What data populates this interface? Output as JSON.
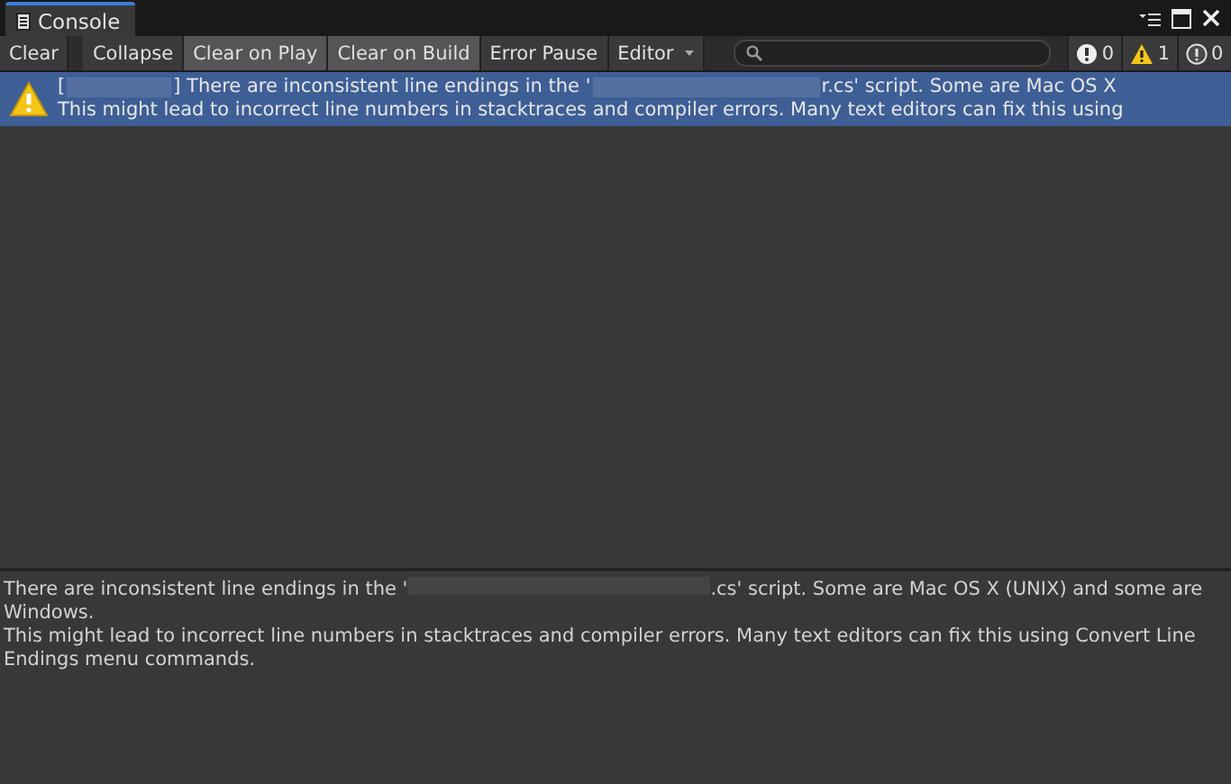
{
  "window": {
    "tab": "Console"
  },
  "toolbar": {
    "buttons": [
      {
        "label": "Clear",
        "kind": "button",
        "selected": false
      },
      {
        "label": "Collapse",
        "kind": "toggle",
        "selected": false
      },
      {
        "label": "Clear on Play",
        "kind": "toggle",
        "selected": true
      },
      {
        "label": "Clear on Build",
        "kind": "toggle",
        "selected": true
      },
      {
        "label": "Error Pause",
        "kind": "toggle",
        "selected": false
      },
      {
        "label": "Editor",
        "kind": "dropdown",
        "selected": false
      }
    ],
    "counters": [
      {
        "kind": "error",
        "count": "0"
      },
      {
        "kind": "warning",
        "count": "1"
      },
      {
        "kind": "info",
        "count": "0"
      }
    ]
  },
  "log": [
    {
      "kind": "warning",
      "selected": true,
      "line_1_start": "[",
      "line_1_end": "] There are inconsistent line endings in the '",
      "line_1_file_end": "r.cs' script. Some are Mac OS X",
      "line_2": "This might lead to incorrect line numbers in stacktraces and compiler errors. Many text editors can fix this using"
    }
  ],
  "details": {
    "line_1_start": "There are inconsistent line endings in the '",
    "line_1_end": ".cs' script. Some are Mac OS X (UNIX) and some are Windows.",
    "line_2": "This might lead to incorrect line numbers in stacktraces and compiler errors. Many text editors can fix this using Convert Line Endings menu commands."
  }
}
